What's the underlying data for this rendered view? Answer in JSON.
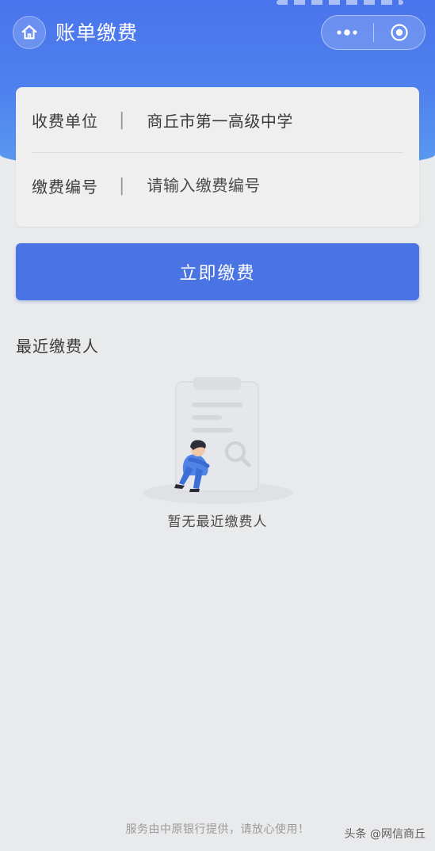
{
  "header": {
    "title": "账单缴费",
    "home_icon": "home-icon",
    "more_icon": "more-dots-icon",
    "close_icon": "target-circle-icon",
    "accent_color": "#4a74ec"
  },
  "form": {
    "payee": {
      "label": "收费单位",
      "value": "商丘市第一高级中学"
    },
    "payment_number": {
      "label": "缴费编号",
      "placeholder": "请输入缴费编号",
      "value": ""
    }
  },
  "pay_button": {
    "label": "立即缴费",
    "color": "#4a73e3"
  },
  "recent": {
    "title": "最近缴费人",
    "empty_text": "暂无最近缴费人",
    "empty_icon": "empty-clipboard-illustration"
  },
  "footer": {
    "note": "服务由中原银行提供，请放心使用！"
  },
  "watermark": {
    "text": "头条 @网信商丘"
  }
}
